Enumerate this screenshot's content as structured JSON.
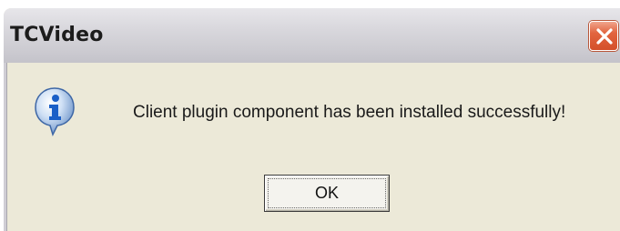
{
  "window": {
    "title": "TCVideo"
  },
  "titlebar": {
    "close_icon": "close-x-icon"
  },
  "body": {
    "icon": "information-icon",
    "message": "Client plugin component has been installed successfully!"
  },
  "buttons": {
    "ok_label": "OK"
  },
  "colors": {
    "dialog_bg": "#ece9d8",
    "close_button": "#e2643f",
    "info_icon_blue": "#1a5fc7"
  }
}
